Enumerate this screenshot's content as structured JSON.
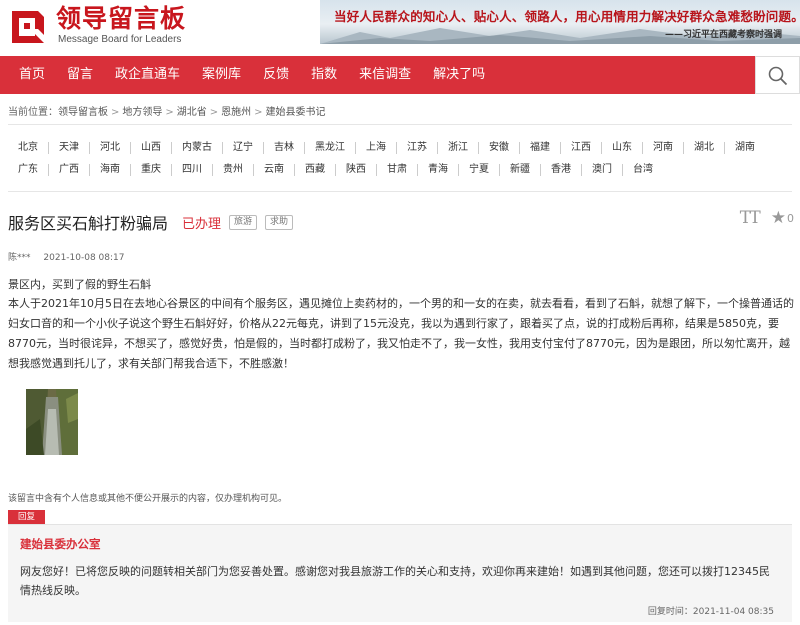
{
  "header": {
    "logo_title": "领导留言板",
    "logo_subtitle": "Message Board for Leaders",
    "banner_main": "当好人民群众的知心人、贴心人、领路人，用心用情用力解决好群众急难愁盼问题。",
    "banner_quote": "——习近平在西藏考察时强调"
  },
  "nav": {
    "items": [
      "首页",
      "留言",
      "政企直通车",
      "案例库",
      "反馈",
      "指数",
      "来信调查",
      "解决了吗"
    ],
    "search_icon": "search-icon"
  },
  "breadcrumb": {
    "prefix": "当前位置：",
    "items": [
      "领导留言板",
      "地方领导",
      "湖北省",
      "恩施州",
      "建始县委书记"
    ]
  },
  "provinces": {
    "row1": [
      "北京",
      "天津",
      "河北",
      "山西",
      "内蒙古",
      "辽宁",
      "吉林",
      "黑龙江",
      "上海",
      "江苏",
      "浙江",
      "安徽",
      "福建",
      "江西",
      "山东",
      "河南",
      "湖北",
      "湖南"
    ],
    "row2": [
      "广东",
      "广西",
      "海南",
      "重庆",
      "四川",
      "贵州",
      "云南",
      "西藏",
      "陕西",
      "甘肃",
      "青海",
      "宁夏",
      "新疆",
      "香港",
      "澳门",
      "台湾"
    ]
  },
  "message": {
    "title": "服务区买石斛打粉骗局",
    "status": "已办理",
    "tags": [
      "旅游",
      "求助"
    ],
    "font_toggle_label": "TT",
    "favorite_count": "0",
    "author": "陈***",
    "date": "2021-10-08 08:17",
    "heading": "景区内，买到了假的野生石斛",
    "body": "本人于2021年10月5日在去地心谷景区的中间有个服务区，遇见摊位上卖药材的，一个男的和一女的在卖，就去看看，看到了石斛，就想了解下，一个操普通话的妇女口音的和一个小伙子说这个野生石斛好好，价格从22元每克，讲到了15元没克，我以为遇到行家了，跟着买了点，说的打成粉后再称，结果是5850克，要8770元，当时很诧异，不想买了，感觉好贵，怕是假的，当时都打成粉了，我又怕走不了，我一女性，我用支付宝付了8770元，因为是跟团，所以匆忙离开，越想我感觉遇到托儿了，求有关部门帮我合适下，不胜感激！",
    "disclaimer": "该留言中含有个人信息或其他不便公开展示的内容，仅办理机构可见。"
  },
  "reply": {
    "badge": "回复",
    "org": "建始县委办公室",
    "text": "网友您好！已将您反映的问题转相关部门为您妥善处置。感谢您对我县旅游工作的关心和支持，欢迎你再来建始！如遇到其他问题，您还可以拨打12345民情热线反映。",
    "time_label": "回复时间：",
    "time": "2021-11-04 08:35"
  },
  "colors": {
    "brand_red": "#d9303a",
    "logo_red": "#c8161d"
  }
}
